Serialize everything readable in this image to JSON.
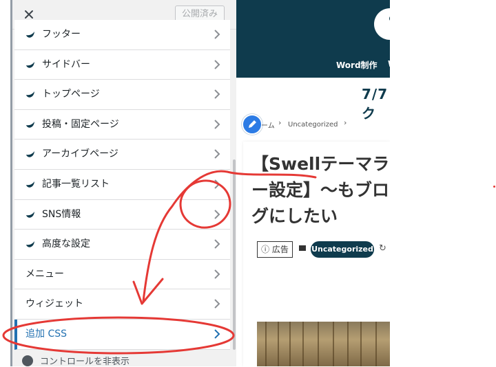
{
  "customizer": {
    "close_icon": "close-icon",
    "publish_label": "公開済み",
    "menu": [
      {
        "label": "フッター",
        "icon": "swell-icon"
      },
      {
        "label": "サイドバー",
        "icon": "swell-icon"
      },
      {
        "label": "トップページ",
        "icon": "swell-icon"
      },
      {
        "label": "投稿・固定ページ",
        "icon": "swell-icon"
      },
      {
        "label": "アーカイブページ",
        "icon": "swell-icon"
      },
      {
        "label": "記事一覧リスト",
        "icon": "swell-icon"
      },
      {
        "label": "SNS情報",
        "icon": "swell-icon"
      },
      {
        "label": "高度な設定",
        "icon": "swell-icon"
      },
      {
        "label": "メニュー"
      },
      {
        "label": "ウィジェット"
      },
      {
        "label": "追加 CSS"
      }
    ],
    "footer_label": "コントロールを非表示"
  },
  "preview": {
    "nav_item": "Word制作",
    "nav_item_partial": "W",
    "notice": "7/7ク",
    "breadcrumb": {
      "home": "ーム",
      "sep": "›",
      "category": "Uncategorized"
    },
    "post_title": "【Swellテーマラー設定】～もブログにしたい",
    "ad_label": "広告",
    "category_badge": "Uncategorized"
  },
  "colors": {
    "header_bg": "#0f3b4d",
    "accent_blue": "#2271b1",
    "annotation_red": "#e53935"
  }
}
